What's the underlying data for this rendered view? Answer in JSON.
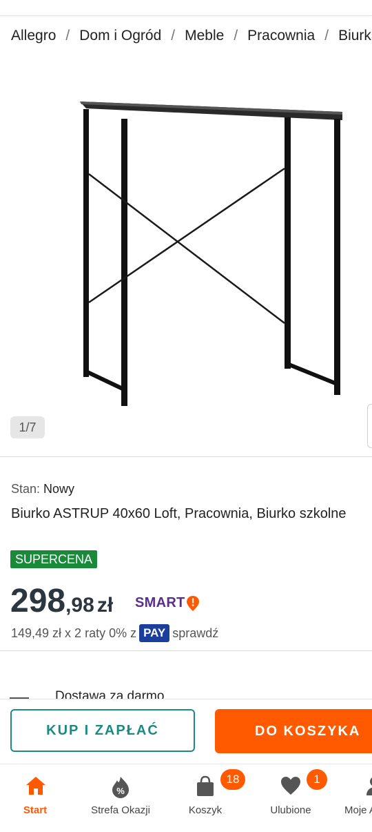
{
  "breadcrumb": [
    "Allegro",
    "Dom i Ogród",
    "Meble",
    "Pracownia",
    "Biurka"
  ],
  "gallery": {
    "counter": "1/7"
  },
  "product": {
    "condition_label": "Stan:",
    "condition_value": "Nowy",
    "title": "Biurko ASTRUP 40x60 Loft, Pracownia, Biurko szkolne",
    "badge": "SUPERCENA",
    "price_int": "298",
    "price_dec": ",98",
    "price_cur": "zł",
    "smart_label": "SMART",
    "installments_text": "149,49 zł x 2 raty 0% z",
    "pay_label": "PAY",
    "installments_link": "sprawdź",
    "delivery": "Dostawa za darmo"
  },
  "actions": {
    "buy_label": "KUP I ZAPŁAĆ",
    "cart_label": "DO KOSZYKA"
  },
  "nav": {
    "items": [
      {
        "label": "Start",
        "icon": "home-icon",
        "active": true
      },
      {
        "label": "Strefa Okazji",
        "icon": "deals-tag-icon"
      },
      {
        "label": "Koszyk",
        "icon": "cart-bag-icon",
        "count": "18"
      },
      {
        "label": "Ulubione",
        "icon": "heart-icon",
        "count": "1"
      },
      {
        "label": "Moje Allegro",
        "icon": "user-icon"
      }
    ]
  },
  "colors": {
    "accent": "#ff5a00",
    "teal": "#1a8a82",
    "badge_green": "#1a8a3a",
    "pay_blue": "#1b3f9a",
    "smart_purple": "#5b2d8e"
  }
}
